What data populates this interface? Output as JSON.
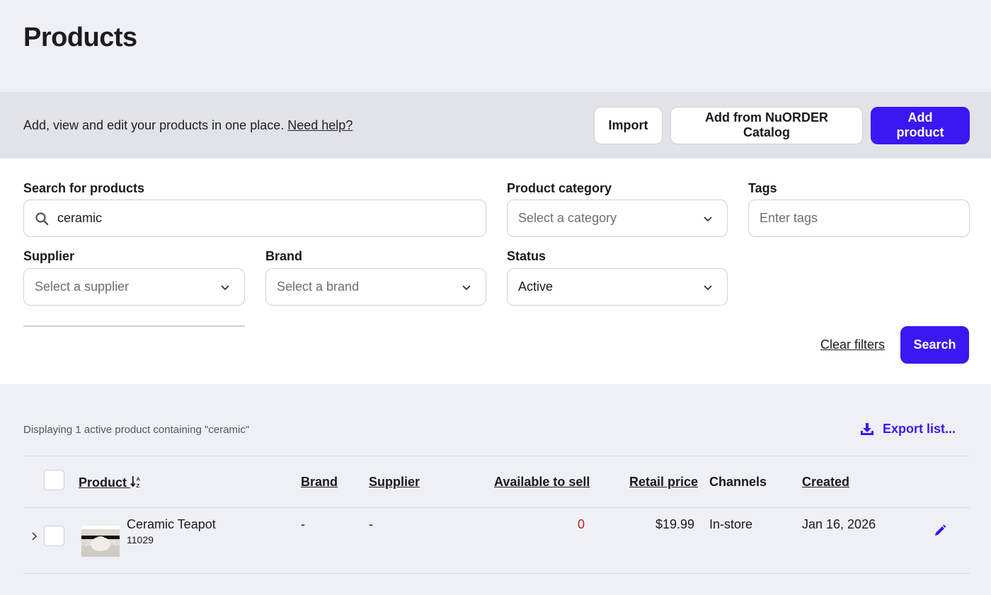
{
  "page": {
    "title": "Products"
  },
  "banner": {
    "text": "Add, view and edit your products in one place.",
    "help_link": "Need help?",
    "import_label": "Import",
    "catalog_label": "Add from NuORDER Catalog",
    "add_label": "Add product"
  },
  "filters": {
    "search_label": "Search for products",
    "search_value": "ceramic",
    "category_label": "Product category",
    "category_placeholder": "Select a category",
    "tags_label": "Tags",
    "tags_placeholder": "Enter tags",
    "supplier_label": "Supplier",
    "supplier_placeholder": "Select a supplier",
    "brand_label": "Brand",
    "brand_placeholder": "Select a brand",
    "status_label": "Status",
    "status_value": "Active",
    "clear_label": "Clear filters",
    "search_button": "Search"
  },
  "results": {
    "summary": "Displaying 1 active product containing \"ceramic\"",
    "export_label": "Export list..."
  },
  "table": {
    "columns": {
      "product": "Product",
      "brand": "Brand",
      "supplier": "Supplier",
      "available": "Available to sell",
      "retail": "Retail price",
      "channels": "Channels",
      "created": "Created"
    },
    "rows": [
      {
        "name": "Ceramic Teapot",
        "sku": "11029",
        "brand": "-",
        "supplier": "-",
        "available": "0",
        "retail": "$19.99",
        "channels": "In-store",
        "created": "Jan 16, 2026"
      }
    ]
  },
  "colors": {
    "accent": "#3b17f2",
    "danger": "#b3261e"
  },
  "icons": [
    "search-icon",
    "chevron-down-icon",
    "download-icon",
    "sort-az-icon",
    "chevron-right-icon",
    "pencil-icon"
  ]
}
